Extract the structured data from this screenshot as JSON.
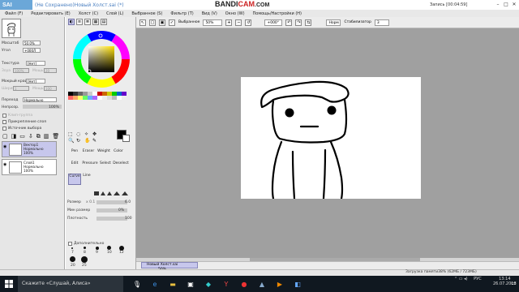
{
  "title_bar": {
    "app_logo": "SAI",
    "document_title": "(Не Сохранено)Новый Холст.sai (*)",
    "recorder": {
      "brand_main": "BANDI",
      "brand_accent": "CAM",
      "domain": ".COM",
      "record_status": "Запись [00:04:59]"
    }
  },
  "menu": [
    "Файл (F)",
    "Редактировать (E)",
    "Холст (C)",
    "Слой (L)",
    "Выбранное (S)",
    "Фильтр (T)",
    "Вид (V)",
    "Окно (W)",
    "Помощь/Настройки (H)"
  ],
  "toolbar": {
    "selection_label": "Выбранное",
    "zoom": "50%",
    "rotation": "+000°",
    "blend_mode": "Норм",
    "stabilizer_label": "Стабилизатор",
    "stabilizer_value": "3"
  },
  "navigator": {
    "zoom_label": "Масштаб",
    "zoom_value": "50.0%",
    "angle_label": "Угол",
    "angle_value": "+000Л"
  },
  "texture": {
    "label": "Текстура",
    "value": "[Нет]",
    "scale_label": "Зоуа",
    "scale_value": "100%",
    "strength_label": "Мощь",
    "strength_value": "20"
  },
  "edge": {
    "label": "Мокрый край",
    "value": "[Нет]",
    "width_label": "Ширина",
    "width_value": "1",
    "strength_label": "Мощь",
    "strength_value": "100"
  },
  "layer_props": {
    "mode_label": "Переход",
    "mode_value": "Нормально",
    "opacity_label": "Непрозр.",
    "opacity_value": "100%",
    "checks": [
      "Клип-группа",
      "Прикрепление слоя",
      "Источник выбора"
    ]
  },
  "layers": [
    {
      "name": "Вектор1",
      "mode": "Нормально",
      "opacity": "100%",
      "selected": true
    },
    {
      "name": "Слой1",
      "mode": "Нормально",
      "opacity": "100%",
      "selected": false
    }
  ],
  "tools": {
    "row1": [
      "Pen",
      "Eraser",
      "Weight",
      "Color"
    ],
    "row2": [
      "Edit",
      "Pressure",
      "Select",
      "Deselect"
    ],
    "row3": [
      "Curve",
      "Line"
    ]
  },
  "brush": {
    "size_label": "Размер",
    "size_mult": "x 0.1",
    "size_value": "6.0",
    "min_size_label": "Мин размер",
    "min_size_value": "0%",
    "density_label": "Плотность",
    "density_value": "100",
    "advanced_label": "Дополнительно",
    "presets": [
      "7",
      "8",
      "9",
      "10",
      "12",
      "15",
      "20",
      "25",
      "30"
    ]
  },
  "statusbar": {
    "doc_tab": "Новый Холст.sai",
    "doc_zoom": "50%",
    "memory": "Загрузка памяти38% (62МБ / 723МБ)"
  },
  "taskbar": {
    "cortana": "Скажите «Слушай, Алиса»",
    "lang": "РУС",
    "time": "13:14",
    "date": "26.07.2018"
  },
  "colors": {
    "accent_selection": "#c7c7ec",
    "workspace": "#a0a0a0",
    "taskbar": "#101820"
  }
}
